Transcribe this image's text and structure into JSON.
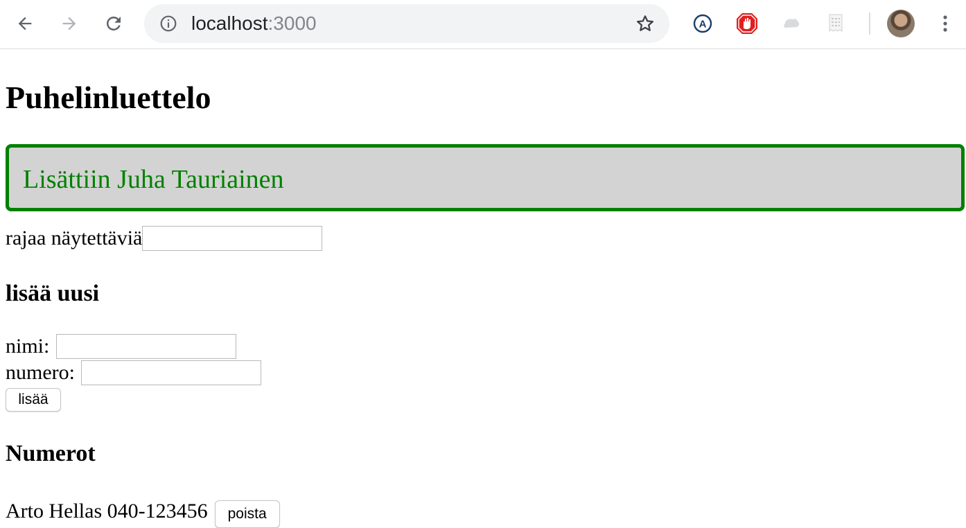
{
  "browser": {
    "url_host": "localhost",
    "url_port": ":3000",
    "icons": {
      "back": "back-arrow-icon",
      "forward": "forward-arrow-icon",
      "reload": "reload-icon",
      "info": "info-icon",
      "bookmark": "star-icon",
      "extensions": [
        "translate-extension-icon",
        "adblock-extension-icon",
        "cloud-extension-icon",
        "receipt-extension-icon"
      ],
      "profile": "avatar",
      "menu": "kebab-menu-icon"
    }
  },
  "page": {
    "title": "Puhelinluettelo",
    "notification": "Lisättiin Juha Tauriainen",
    "filter_label": "rajaa näytettäviä",
    "filter_value": "",
    "add_heading": "lisää uusi",
    "name_label": "nimi:",
    "name_value": "",
    "number_label": "numero:",
    "number_value": "",
    "add_button": "lisää",
    "numbers_heading": "Numerot",
    "entries": [
      {
        "text": "Arto Hellas 040-123456",
        "delete_label": "poista"
      }
    ]
  },
  "colors": {
    "notification_border": "#008000",
    "notification_text": "#008000",
    "notification_background": "#d3d3d3"
  }
}
